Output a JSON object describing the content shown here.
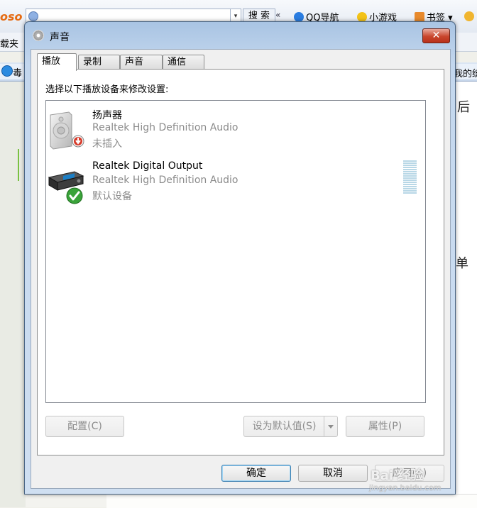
{
  "browser": {
    "logo": "oso",
    "search_button": "搜 索",
    "chevron": "«",
    "links": [
      "QQ导航",
      "小游戏",
      "书签"
    ],
    "menu_fragment": "载夹",
    "tab_left": "毒",
    "tab_right": "我的统",
    "page_text_1": "后",
    "page_text_2": "单",
    "bottom_text": ""
  },
  "dialog": {
    "title": "声音",
    "close_label": "✕",
    "tabs": [
      "播放",
      "录制",
      "声音",
      "通信"
    ],
    "active_tab": 0,
    "instruction": "选择以下播放设备来修改设置:",
    "devices": [
      {
        "name": "扬声器",
        "driver": "Realtek High Definition Audio",
        "status": "未插入",
        "icon": "speaker-icon",
        "badge": "unplugged-badge-icon"
      },
      {
        "name": "Realtek Digital Output",
        "driver": "Realtek High Definition Audio",
        "status": "默认设备",
        "icon": "digital-output-icon",
        "badge": "default-checkmark-icon"
      }
    ],
    "buttons": {
      "configure": "配置(C)",
      "set_default": "设为默认值(S)",
      "properties": "属性(P)",
      "ok": "确定",
      "cancel": "取消",
      "apply": "应用(A)"
    }
  },
  "watermark": {
    "line1": "Bai 经验",
    "line2": "jingyan.baidu.com"
  },
  "colors": {
    "dialog_frame": "#c3d7ee",
    "close_button": "#c9462d",
    "disabled_text": "#8d8d8d",
    "secondary_text": "#8b8b8b"
  }
}
